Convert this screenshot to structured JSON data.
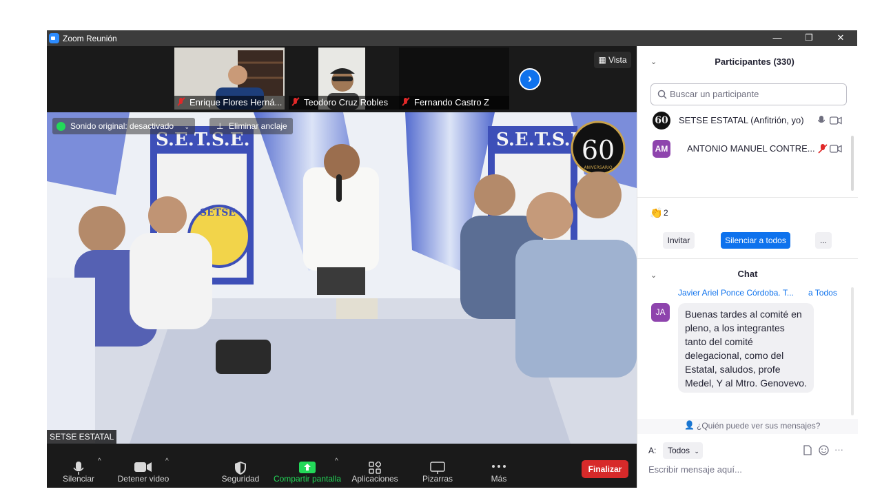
{
  "window": {
    "title": "Zoom Reunión",
    "minimize": "—",
    "maximize": "❐",
    "close": "✕"
  },
  "thumbnails": [
    {
      "name": "Enrique Flores Hernández",
      "display": "Enrique Flores Herná..."
    },
    {
      "name": "Teodoro Cruz Robles",
      "display": "Teodoro Cruz Robles"
    },
    {
      "name": "Fernando Castro Z",
      "display": "Fernando Castro Z"
    }
  ],
  "view_button": "Vista",
  "overlay": {
    "audio_status": "Sonido original: desactivado",
    "unpin": "Eliminar anclaje"
  },
  "main_speaker": "SETSE ESTATAL",
  "banner": {
    "left_title": "S.E.T.S.E.",
    "right_title": "S.E.T.S.E",
    "badge": "60",
    "badge_caption": "ANIVERSARIO",
    "seal_text": "SETSE"
  },
  "toolbar": {
    "mute": "Silenciar",
    "video": "Detener video",
    "security": "Seguridad",
    "share": "Compartir pantalla",
    "apps": "Aplicaciones",
    "whiteboards": "Pizarras",
    "more": "Más",
    "end": "Finalizar"
  },
  "participants": {
    "title": "Participantes (330)",
    "search_placeholder": "Buscar un participante",
    "list": [
      {
        "initials": "60",
        "name": "SETSE ESTATAL (Anfitrión, yo)"
      },
      {
        "initials": "AM",
        "name": "ANTONIO MANUEL CONTRE..."
      }
    ],
    "reaction_count": "2",
    "invite": "Invitar",
    "mute_all": "Silenciar a todos",
    "more": "..."
  },
  "chat": {
    "title": "Chat",
    "sender": "Javier Ariel Ponce Córdoba. T...",
    "to": "a Todos",
    "initials": "JA",
    "message": "Buenas tardes al comité en pleno, a los integrantes tanto del comité delegacional, como del Estatal, saludos, profe Medel, Y al Mtro. Genovevo.",
    "visibility": "¿Quién puede ver sus mensajes?",
    "to_label": "A:",
    "recipient": "Todos",
    "input_placeholder": "Escribir mensaje aquí..."
  },
  "colors": {
    "zoom_blue": "#0e72ed",
    "end_red": "#d72a2a",
    "share_green": "#23d959",
    "muted_red": "#e02828",
    "avatar_purple": "#8e44ad"
  }
}
